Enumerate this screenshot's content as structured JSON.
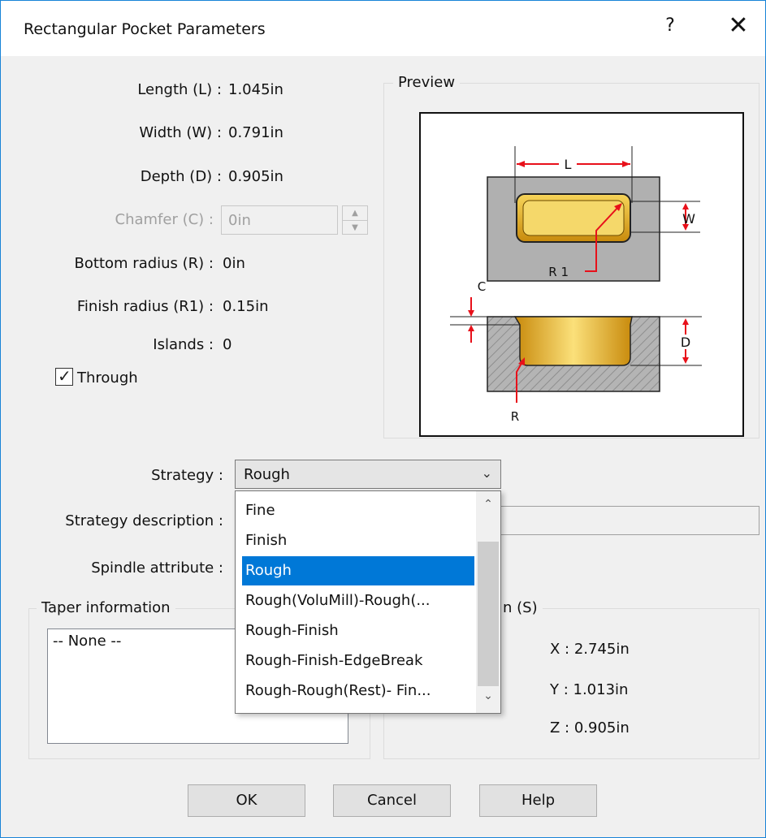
{
  "dialog": {
    "title": "Rectangular Pocket Parameters",
    "help_glyph": "?",
    "close_glyph": "✕"
  },
  "params": {
    "length_label": "Length (L) :",
    "length_value": "1.045in",
    "width_label": "Width (W) :",
    "width_value": "0.791in",
    "depth_label": "Depth (D) :",
    "depth_value": "0.905in",
    "chamfer_label": "Chamfer (C) :",
    "chamfer_value": "0in",
    "bottom_radius_label": "Bottom radius (R) :",
    "bottom_radius_value": "0in",
    "finish_radius_label": "Finish radius (R1) :",
    "finish_radius_value": "0.15in",
    "islands_label": "Islands :",
    "islands_value": "0",
    "through_label": "Through",
    "through_checked": true
  },
  "preview": {
    "label": "Preview",
    "dim_L": "L",
    "dim_W": "W",
    "dim_R1": "R 1",
    "dim_C": "C",
    "dim_D": "D",
    "dim_R": "R"
  },
  "strategy": {
    "label": "Strategy :",
    "selected": "Rough",
    "options": [
      "Fine",
      "Finish",
      "Rough",
      "Rough(VoluMill)-Rough(...",
      "Rough-Finish",
      "Rough-Finish-EdgeBreak",
      "Rough-Rough(Rest)- Fin..."
    ],
    "description_label": "Strategy description :",
    "spindle_label": "Spindle attribute :"
  },
  "taper": {
    "label": "Taper information",
    "value": "-- None --"
  },
  "start_point": {
    "label_partial": "n (S)",
    "x": "X : 2.745in",
    "y": "Y : 1.013in",
    "z": "Z : 0.905in"
  },
  "buttons": {
    "ok": "OK",
    "cancel": "Cancel",
    "help": "Help"
  },
  "colors": {
    "accent": "#0078d7",
    "dimension_red": "#e8101a",
    "gold": "#e8a915"
  }
}
